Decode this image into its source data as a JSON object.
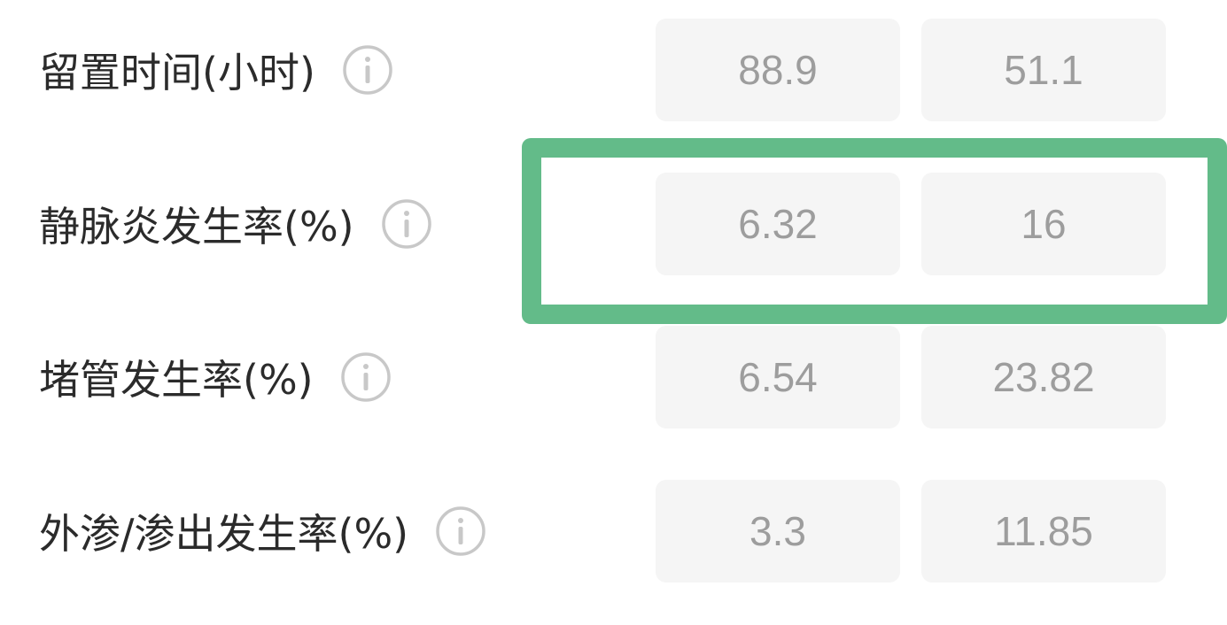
{
  "rows": [
    {
      "label": "留置时间(小时)",
      "info_icon": "info-icon",
      "value_a": "88.9",
      "value_b": "51.1"
    },
    {
      "label": "静脉炎发生率(%)",
      "info_icon": "info-icon",
      "value_a": "6.32",
      "value_b": "16"
    },
    {
      "label": "堵管发生率(%)",
      "info_icon": "info-icon",
      "value_a": "6.54",
      "value_b": "23.82"
    },
    {
      "label": "外渗/渗出发生率(%)",
      "info_icon": "info-icon",
      "value_a": "3.3",
      "value_b": "11.85"
    }
  ],
  "highlight": {
    "row": 1,
    "color": "#63bb89"
  },
  "colors": {
    "label_text": "#2b2b2b",
    "value_text": "#9d9d9d",
    "value_bg": "#f5f5f5",
    "icon_stroke": "#c8c8c8"
  }
}
